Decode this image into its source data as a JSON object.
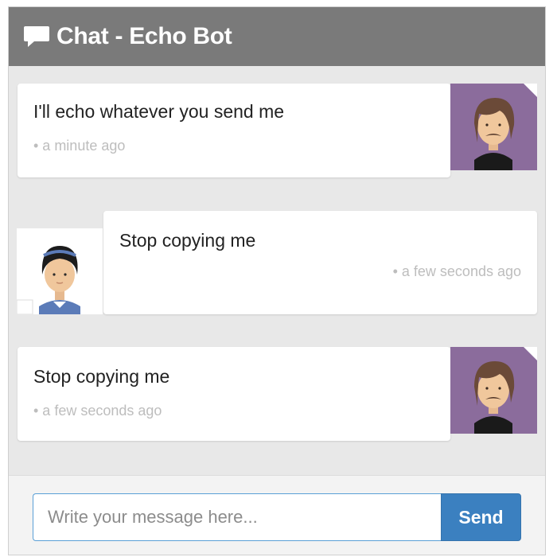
{
  "header": {
    "title": "Chat - Echo Bot",
    "icon": "speech-bubble-icon"
  },
  "messages": [
    {
      "sender": "bot",
      "text": "I'll echo whatever you send me",
      "time": "• a minute ago"
    },
    {
      "sender": "user",
      "text": "Stop copying me",
      "time": "• a few seconds ago"
    },
    {
      "sender": "bot",
      "text": "Stop copying me",
      "time": "• a few seconds ago"
    }
  ],
  "composer": {
    "placeholder": "Write your message here...",
    "value": "",
    "send_label": "Send"
  },
  "colors": {
    "header_bg": "#7a7a7a",
    "chat_bg": "#e8e8e8",
    "bot_avatar_bg": "#8b6c9c",
    "send_button": "#3b80c0",
    "input_border": "#5aa0d6",
    "timestamp": "#bdbdbd"
  }
}
